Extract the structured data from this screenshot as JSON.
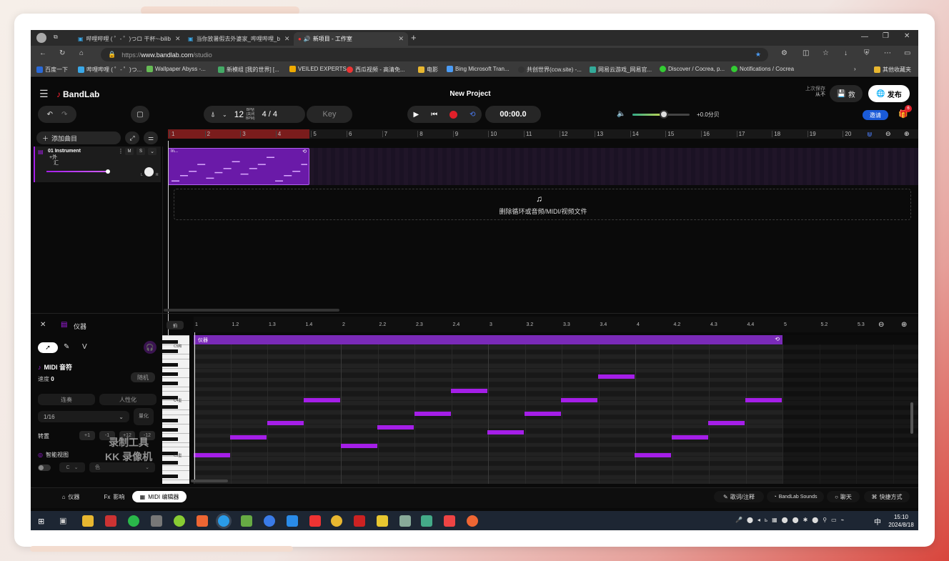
{
  "browser": {
    "tabs": [
      {
        "label": "哔哩哔哩 ( ゜- ゜)つロ 干杯~-bilib",
        "active": false
      },
      {
        "label": "当你放暑假去外婆家_哔哩哔哩_b",
        "active": false
      },
      {
        "label": "新项目 - 工作室",
        "active": true
      }
    ],
    "url_prefix": "https://",
    "url_host": "www.bandlab.com",
    "url_path": "/studio",
    "bookmarks": [
      "百度一下",
      "哔哩哔哩 ( ゜- ゜)つ...",
      "Wallpaper Abyss -...",
      "新模组 [我的世界] [...",
      "VEILED EXPERTS",
      "西瓜视频 - 高清免...",
      "电影",
      "Bing Microsoft Tran...",
      "共创世界(ccw.site) -...",
      "网易云游戏_网易官...",
      "Discover / Cocrea, p...",
      "Notifications / Cocrea",
      "其他收藏夹"
    ]
  },
  "app": {
    "logo": "BandLab",
    "project_title": "New Project",
    "save_status": "上次保存",
    "save_status2": "从不",
    "save_label": "救",
    "publish_label": "发布",
    "invite_label": "邀请",
    "gift_badge": "6",
    "tempo": "12",
    "tempo_unit": "BPM",
    "tempo_sub": "(关闭",
    "tempo_sub2": "BPM)",
    "time_sig": "4 / 4",
    "key_label": "Key",
    "timecode": "00:00.0",
    "volume_readout": "+0.0分贝",
    "volume_level": 0.55,
    "add_track_label": "添加曲目"
  },
  "track": {
    "name": "01 Instrument",
    "mute": "M",
    "solo": "S",
    "sub1": "+外",
    "sub2": "汇",
    "pan_left": "L",
    "pan_right": "R",
    "clip_label": "In...",
    "drop_hint": "删除循环或音频/MIDI/视频文件"
  },
  "ruler_top": [
    "1",
    "2",
    "3",
    "4",
    "5",
    "6",
    "7",
    "8",
    "9",
    "10",
    "11",
    "12",
    "13",
    "14",
    "15",
    "16",
    "17",
    "18",
    "19",
    "20"
  ],
  "editor": {
    "title": "仪器",
    "snap_label": "拍",
    "ruler": [
      "1",
      "1.2",
      "1.3",
      "1.4",
      "2",
      "2.2",
      "2.3",
      "2.4",
      "3",
      "3.2",
      "3.3",
      "3.4",
      "4",
      "4.2",
      "4.3",
      "4.4",
      "5",
      "5.2",
      "5.3"
    ],
    "region_label": "仪器",
    "tool_v": "V",
    "section_title": "MIDI 音符",
    "velocity_label": "速度",
    "velocity_value": "0",
    "random_label": "随机",
    "legato_label": "连奏",
    "humanize_label": "人性化",
    "quantize_value": "1/16",
    "quantize_label": "量化",
    "transpose_label": "转置",
    "transpose_btns": [
      "+1",
      "-1",
      "+12",
      "-12"
    ],
    "smart_view_label": "智能视图",
    "scale_key": "C",
    "scale_color": "色",
    "key_labels": [
      "C5和",
      "C4型",
      "C3型"
    ],
    "watermark1": "录制工具",
    "watermark2": "KK 录像机"
  },
  "bottom_tabs": [
    {
      "label": "仪器",
      "active": false
    },
    {
      "label": "影响",
      "prefix": "Fx",
      "active": false
    },
    {
      "label": "MIDI 编辑器",
      "active": true
    }
  ],
  "bottom_right": [
    "歌词/注释",
    "BandLab Sounds",
    "聊天",
    "快捷方式"
  ],
  "taskbar": {
    "time": "15:10",
    "date": "2024/8/18",
    "ime": "中"
  },
  "colors": {
    "accent": "#a51ee8",
    "record": "#e0202a",
    "invite": "#1a5bd8",
    "clip": "#6a1aa8"
  }
}
